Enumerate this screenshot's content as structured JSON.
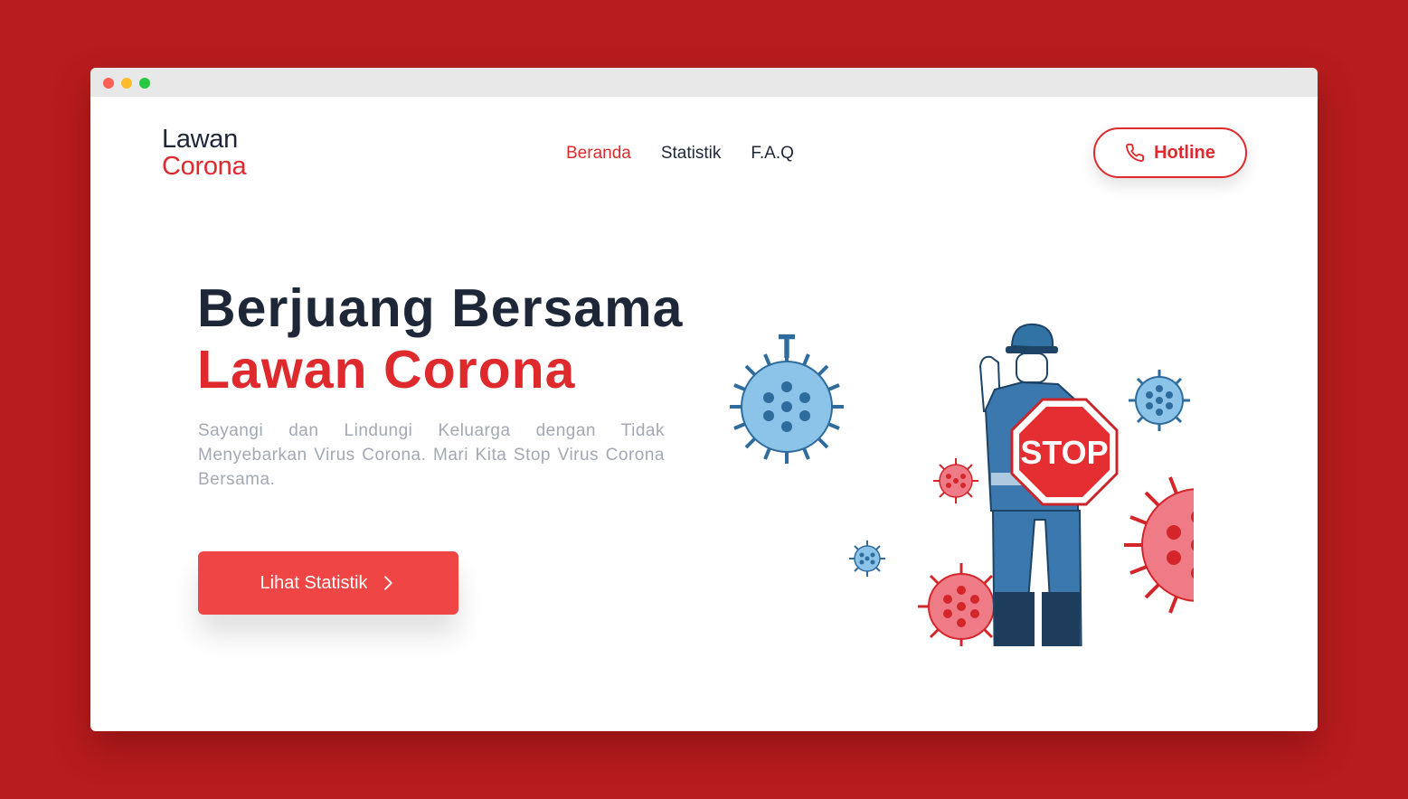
{
  "brand": {
    "line1": "Lawan",
    "line2": "Corona"
  },
  "nav": {
    "items": [
      {
        "label": "Beranda",
        "active": true
      },
      {
        "label": "Statistik",
        "active": false
      },
      {
        "label": "F.A.Q",
        "active": false
      }
    ]
  },
  "hotline": {
    "label": "Hotline",
    "icon": "phone-icon"
  },
  "hero": {
    "title_line1": "Berjuang Bersama",
    "title_line2": "Lawan Corona",
    "description": "Sayangi dan Lindungi Keluarga dengan Tidak Menyebarkan Virus Corona. Mari Kita Stop Virus Corona Bersama.",
    "cta_label": "Lihat Statistik",
    "cta_icon": "chevron-right-icon"
  },
  "illustration": {
    "sign_text": "STOP"
  },
  "colors": {
    "background": "#b71c1e",
    "accent": "#df2a2d",
    "button": "#ef4545",
    "dark_text": "#1e2738",
    "muted_text": "#a3a8b3"
  }
}
